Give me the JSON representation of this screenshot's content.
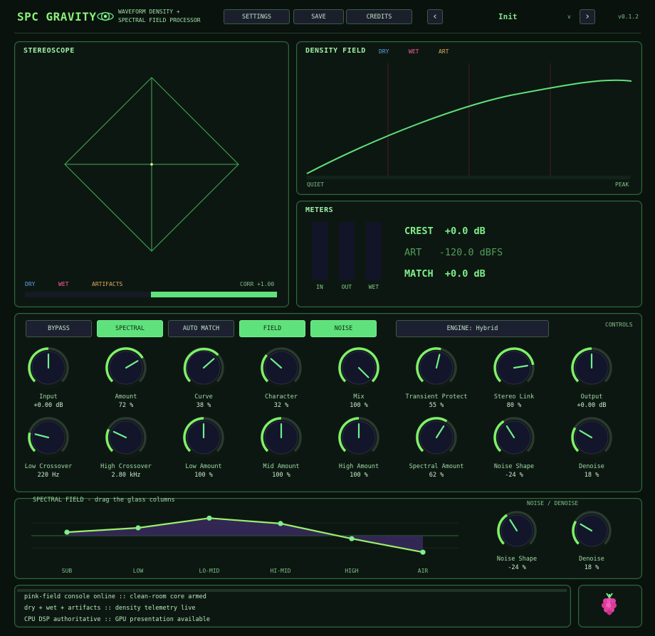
{
  "header": {
    "title": "SPC GRAVITY",
    "subtitle1": "WAVEFORM DENSITY +",
    "subtitle2": "SPECTRAL FIELD PROCESSOR",
    "settings": "SETTINGS",
    "save": "SAVE",
    "credits": "CREDITS",
    "prev": "‹",
    "preset": "Init",
    "dropdown": "v",
    "next": "›",
    "version": "v0.1.2"
  },
  "stereoscope": {
    "title": "STEREOSCOPE",
    "legend_dry": "DRY",
    "legend_wet": "WET",
    "legend_art": "ARTIFACTS",
    "corr": "CORR +1.00",
    "corr_value": 1.0
  },
  "density": {
    "title": "DENSITY FIELD",
    "legend_dry": "DRY",
    "legend_wet": "WET",
    "legend_art": "ART",
    "xmin_label": "QUIET",
    "xmax_label": "PEAK"
  },
  "meters": {
    "title": "METERS",
    "labels": [
      "IN",
      "OUT",
      "WET"
    ],
    "crest": "CREST  +0.0 dB",
    "art": "ART   -120.0 dBFS",
    "match": "MATCH  +0.0 dB"
  },
  "controls": {
    "label": "CONTROLS",
    "bypass": "BYPASS",
    "spectral": "SPECTRAL",
    "automatch": "AUTO MATCH",
    "field": "FIELD",
    "noise": "NOISE",
    "engine": "ENGINE:  Hybrid",
    "knobs_row1": [
      {
        "name": "Input",
        "value": "+0.00 dB",
        "level": 0.5
      },
      {
        "name": "Amount",
        "value": "72 %",
        "level": 0.72
      },
      {
        "name": "Curve",
        "value": "38 %",
        "level": 0.68
      },
      {
        "name": "Character",
        "value": "32 %",
        "level": 0.32
      },
      {
        "name": "Mix",
        "value": "100 %",
        "level": 1.0
      },
      {
        "name": "Transient Protect",
        "value": "55 %",
        "level": 0.55
      },
      {
        "name": "Stereo Link",
        "value": "80 %",
        "level": 0.8
      },
      {
        "name": "Output",
        "value": "+0.00 dB",
        "level": 0.5
      }
    ],
    "knobs_row2": [
      {
        "name": "Low Crossover",
        "value": "220 Hz",
        "level": 0.22
      },
      {
        "name": "High Crossover",
        "value": "2.80 kHz",
        "level": 0.26
      },
      {
        "name": "Low Amount",
        "value": "100 %",
        "level": 0.5
      },
      {
        "name": "Mid Amount",
        "value": "100 %",
        "level": 0.5
      },
      {
        "name": "High Amount",
        "value": "100 %",
        "level": 0.5
      },
      {
        "name": "Spectral Amount",
        "value": "62 %",
        "level": 0.62
      },
      {
        "name": "Noise Shape",
        "value": "-24 %",
        "level": 0.38
      },
      {
        "name": "Denoise",
        "value": "18 %",
        "level": 0.28
      }
    ]
  },
  "spectral": {
    "title": "SPECTRAL FIELD - drag the glass columns",
    "bands": [
      "SUB",
      "LOW",
      "LO-MID",
      "HI-MID",
      "HIGH",
      "AIR"
    ],
    "band_levels": [
      0.42,
      0.5,
      0.68,
      0.58,
      0.3,
      0.05
    ],
    "noise_title": "NOISE / DENOISE",
    "knobs": [
      {
        "name": "Noise Shape",
        "value": "-24 %",
        "level": 0.38
      },
      {
        "name": "Denoise",
        "value": "18 %",
        "level": 0.28
      }
    ]
  },
  "console": {
    "line1": "pink-field console online :: clean-room core armed",
    "line2": "dry + wet + artifacts :: density telemetry live",
    "line3": "CPU DSP authoritative :: GPU presentation available"
  },
  "colors": {
    "accent": "#5fe27b",
    "dry": "#5aa6e8",
    "wet": "#ff5fa6",
    "art": "#e0b060",
    "panel_border": "#2f6b3c"
  }
}
